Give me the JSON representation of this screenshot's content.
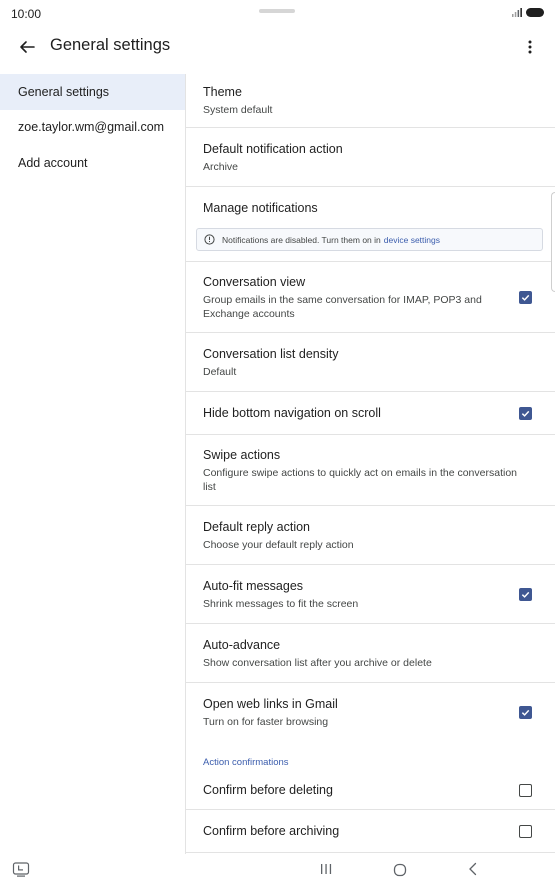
{
  "status_bar": {
    "time": "10:00"
  },
  "app_bar": {
    "title": "General settings"
  },
  "left_nav": {
    "items": [
      {
        "label": "General settings",
        "selected": true
      },
      {
        "label": "zoe.taylor.wm@gmail.com",
        "selected": false
      },
      {
        "label": "Add account",
        "selected": false
      }
    ]
  },
  "settings": {
    "theme": {
      "title": "Theme",
      "subtitle": "System default"
    },
    "default_notification_action": {
      "title": "Default notification action",
      "subtitle": "Archive"
    },
    "manage_notifications": {
      "title": "Manage notifications",
      "notice_text": "Notifications are disabled. Turn them on in",
      "notice_link": "device settings"
    },
    "conversation_view": {
      "title": "Conversation view",
      "subtitle": "Group emails in the same conversation for IMAP, POP3 and Exchange accounts",
      "checked": true
    },
    "conversation_list_density": {
      "title": "Conversation list density",
      "subtitle": "Default"
    },
    "hide_bottom_navigation": {
      "title": "Hide bottom navigation on scroll",
      "checked": true
    },
    "swipe_actions": {
      "title": "Swipe actions",
      "subtitle": "Configure swipe actions to quickly act on emails in the conversation list"
    },
    "default_reply_action": {
      "title": "Default reply action",
      "subtitle": "Choose your default reply action"
    },
    "auto_fit_messages": {
      "title": "Auto-fit messages",
      "subtitle": "Shrink messages to fit the screen",
      "checked": true
    },
    "auto_advance": {
      "title": "Auto-advance",
      "subtitle": "Show conversation list after you archive or delete"
    },
    "open_web_links": {
      "title": "Open web links in Gmail",
      "subtitle": "Turn on for faster browsing",
      "checked": true
    },
    "action_confirmations_header": "Action confirmations",
    "confirm_before_deleting": {
      "title": "Confirm before deleting",
      "checked": false
    },
    "confirm_before_archiving": {
      "title": "Confirm before archiving",
      "checked": false
    }
  },
  "icons": {
    "back": "arrow-left-icon",
    "more": "more-vert-icon",
    "notice": "info-outline-icon",
    "checkbox_checked": "check-icon",
    "nav_recent": "recent-apps-icon",
    "nav_home": "home-icon",
    "nav_back": "chevron-left-icon",
    "nav_extra": "screen-tool-icon"
  },
  "colors": {
    "accent": "#3f5792",
    "link": "#3b5dad",
    "selected_bg": "#e8eef9",
    "divider": "#e3e3e3"
  }
}
